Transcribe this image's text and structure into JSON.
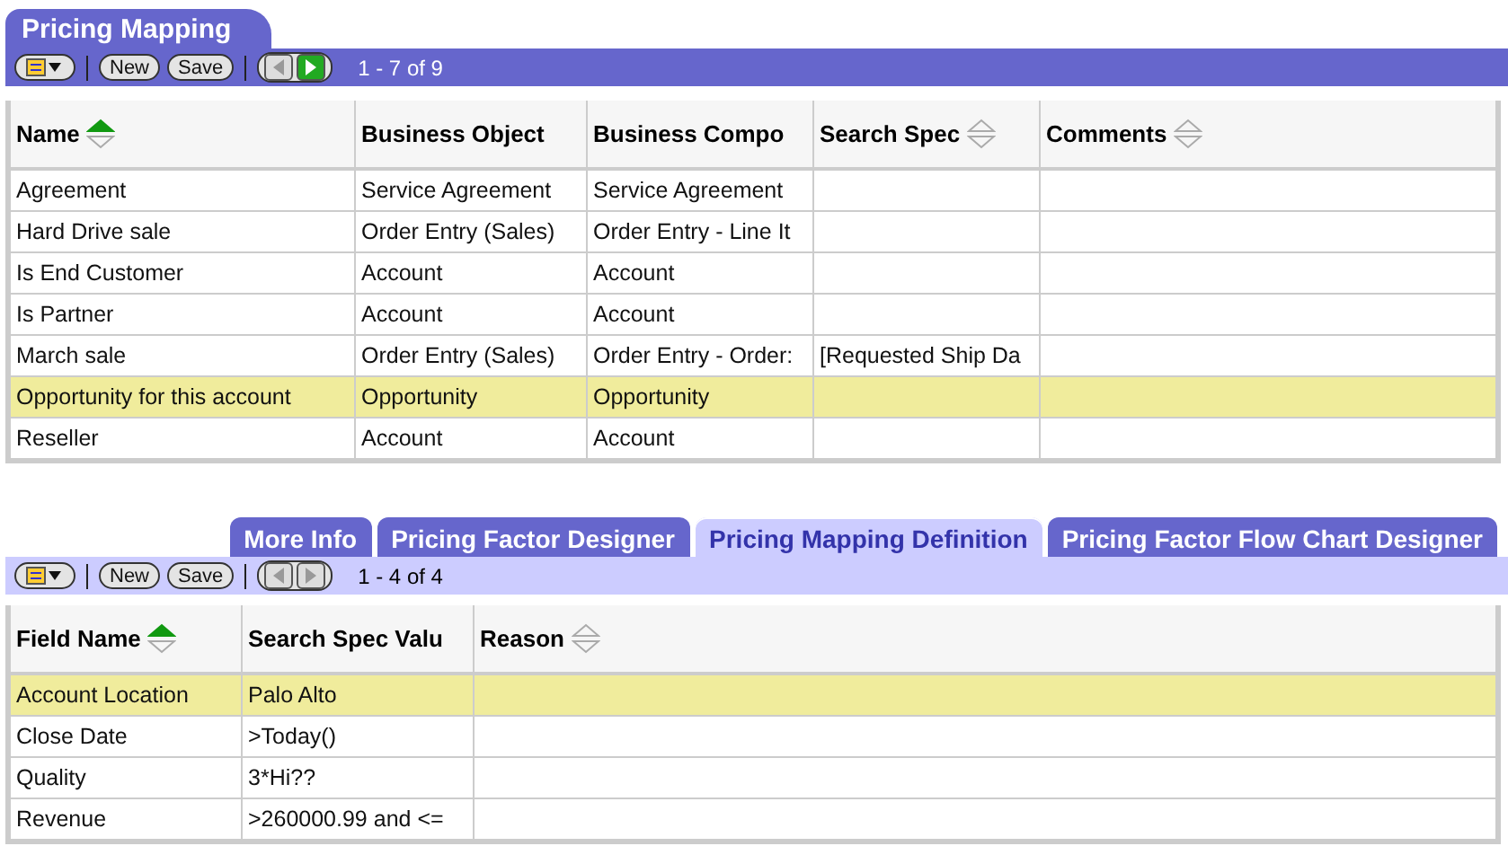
{
  "top_applet": {
    "title": "Pricing Mapping",
    "active": true,
    "toolbar": {
      "buttons": [
        "New",
        "Save"
      ],
      "prev_enabled": false,
      "next_enabled": true,
      "record_count": "1 - 7 of 9"
    },
    "columns": [
      {
        "label": "Name",
        "sortable": true,
        "sorted": true
      },
      {
        "label": "Business Object",
        "sortable": false
      },
      {
        "label": "Business Compo",
        "sortable": false
      },
      {
        "label": "Search Spec",
        "sortable": true,
        "sorted": false
      },
      {
        "label": "Comments",
        "sortable": true,
        "sorted": false
      }
    ],
    "rows": [
      {
        "cells": [
          "Agreement",
          "Service Agreement",
          "Service Agreement",
          "",
          ""
        ],
        "selected": false
      },
      {
        "cells": [
          "Hard Drive sale",
          "Order Entry (Sales)",
          "Order Entry - Line It",
          "",
          ""
        ],
        "selected": false
      },
      {
        "cells": [
          "Is End Customer",
          "Account",
          "Account",
          "",
          ""
        ],
        "selected": false
      },
      {
        "cells": [
          "Is Partner",
          "Account",
          "Account",
          "",
          ""
        ],
        "selected": false
      },
      {
        "cells": [
          "March sale",
          "Order Entry (Sales)",
          "Order Entry - Order:",
          "[Requested Ship Da",
          ""
        ],
        "selected": false
      },
      {
        "cells": [
          "Opportunity for this account",
          "Opportunity",
          "Opportunity",
          "",
          ""
        ],
        "selected": true
      },
      {
        "cells": [
          "Reseller",
          "Account",
          "Account",
          "",
          ""
        ],
        "selected": false
      }
    ]
  },
  "bottom_applet": {
    "active": false,
    "tabs": [
      {
        "label": "More Info",
        "selected": false
      },
      {
        "label": "Pricing Factor Designer",
        "selected": false
      },
      {
        "label": "Pricing Mapping Definition",
        "selected": true
      },
      {
        "label": "Pricing Factor Flow Chart Designer",
        "selected": false
      }
    ],
    "toolbar": {
      "buttons": [
        "New",
        "Save"
      ],
      "prev_enabled": false,
      "next_enabled": false,
      "record_count": "1 - 4 of 4"
    },
    "columns": [
      {
        "label": "Field Name",
        "sortable": true,
        "sorted": true
      },
      {
        "label": "Search Spec Valu",
        "sortable": false
      },
      {
        "label": "Reason",
        "sortable": true,
        "sorted": false
      }
    ],
    "rows": [
      {
        "cells": [
          "Account Location",
          "Palo Alto",
          ""
        ],
        "selected": true
      },
      {
        "cells": [
          "Close Date",
          ">Today()",
          ""
        ],
        "selected": false
      },
      {
        "cells": [
          "Quality",
          "3*Hi??",
          ""
        ],
        "selected": false
      },
      {
        "cells": [
          "Revenue",
          ">260000.99 and <=",
          ""
        ],
        "selected": false
      }
    ]
  }
}
